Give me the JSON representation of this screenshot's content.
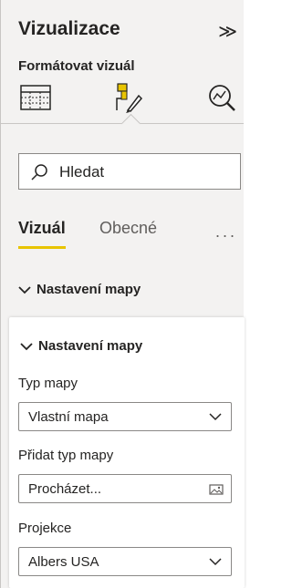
{
  "pane": {
    "title": "Vizualizace",
    "collapse_glyph": "≫",
    "subtitle": "Formátovat vizuál"
  },
  "viz_icons": [
    {
      "name": "table-icon"
    },
    {
      "name": "format-paint-icon",
      "active": true
    },
    {
      "name": "analytics-icon"
    }
  ],
  "search": {
    "placeholder": "Hledat"
  },
  "tabs": [
    {
      "label": "Vizuál",
      "active": true
    },
    {
      "label": "Obecné",
      "active": false
    }
  ],
  "more_glyph": "...",
  "section": {
    "label": "Nastavení mapy"
  },
  "card": {
    "title": "Nastavení mapy",
    "fields": [
      {
        "label": "Typ mapy",
        "value": "Vlastní mapa",
        "kind": "dropdown"
      },
      {
        "label": "Přidat typ mapy",
        "value": "Procházet...",
        "kind": "file"
      },
      {
        "label": "Projekce",
        "value": "Albers USA",
        "kind": "dropdown"
      }
    ]
  },
  "colors": {
    "accent": "#e8c400",
    "pane_bg": "#f3f2f1",
    "border": "#8a8886"
  }
}
